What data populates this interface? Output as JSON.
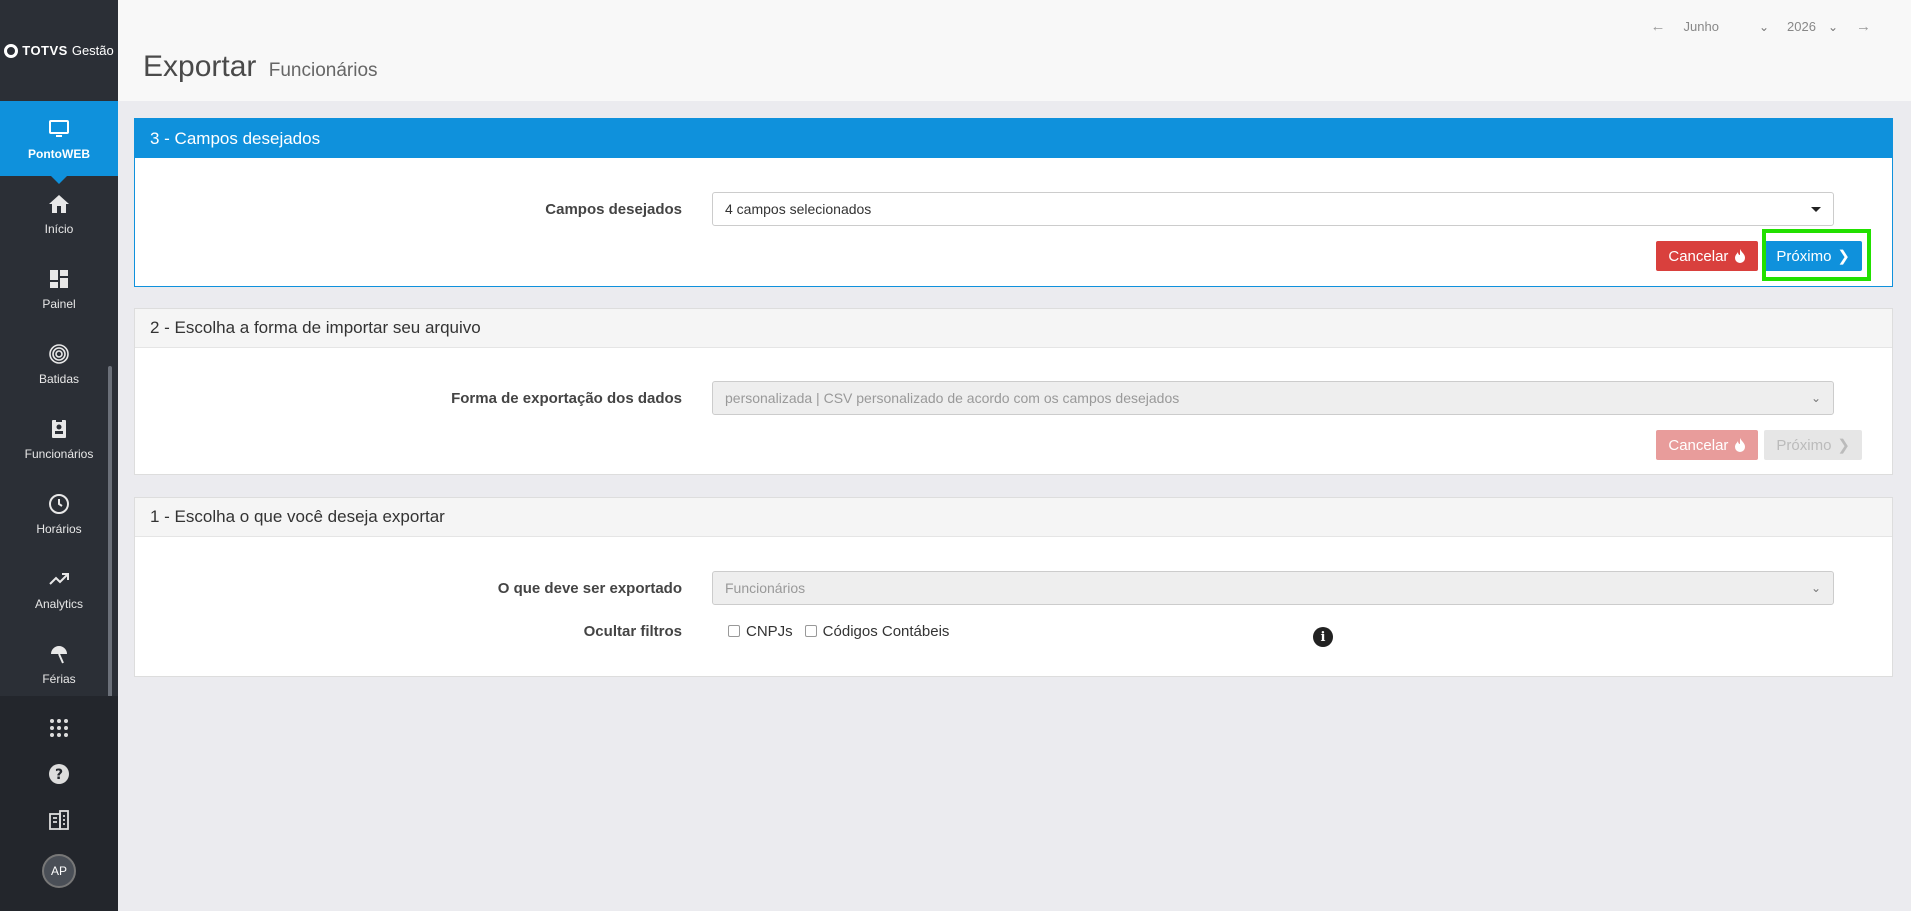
{
  "brand": {
    "name_bold": "TOTVS",
    "name_light": "Gestão"
  },
  "sidebar": {
    "active": {
      "label": "PontoWEB",
      "icon": "monitor-icon"
    },
    "items": [
      {
        "label": "Início",
        "icon": "home-icon"
      },
      {
        "label": "Painel",
        "icon": "dashboard-icon"
      },
      {
        "label": "Batidas",
        "icon": "fingerprint-icon"
      },
      {
        "label": "Funcionários",
        "icon": "badge-icon"
      },
      {
        "label": "Horários",
        "icon": "clock-icon"
      },
      {
        "label": "Analytics",
        "icon": "trend-icon"
      },
      {
        "label": "Férias",
        "icon": "umbrella-icon"
      }
    ],
    "user_initials": "AP"
  },
  "header": {
    "title": "Exportar",
    "subtitle": "Funcionários",
    "month": "Junho",
    "year": "2026"
  },
  "panels": {
    "step3": {
      "title": "3 - Campos desejados",
      "field_label": "Campos desejados",
      "field_value": "4 campos selecionados",
      "cancel_label": "Cancelar",
      "next_label": "Próximo"
    },
    "step2": {
      "title": "2 - Escolha a forma de importar seu arquivo",
      "field_label": "Forma de exportação dos dados",
      "field_value": "personalizada | CSV personalizado de acordo com os campos desejados",
      "cancel_label": "Cancelar",
      "next_label": "Próximo"
    },
    "step1": {
      "title": "1 - Escolha o que você deseja exportar",
      "field_label": "O que deve ser exportado",
      "field_value": "Funcionários",
      "filters_label": "Ocultar filtros",
      "filter_options": [
        "CNPJs",
        "Códigos Contábeis"
      ]
    }
  },
  "colors": {
    "primary": "#0f91dc",
    "danger": "#d9403d",
    "sidebar": "#2b2f36",
    "highlight": "#22e000"
  }
}
